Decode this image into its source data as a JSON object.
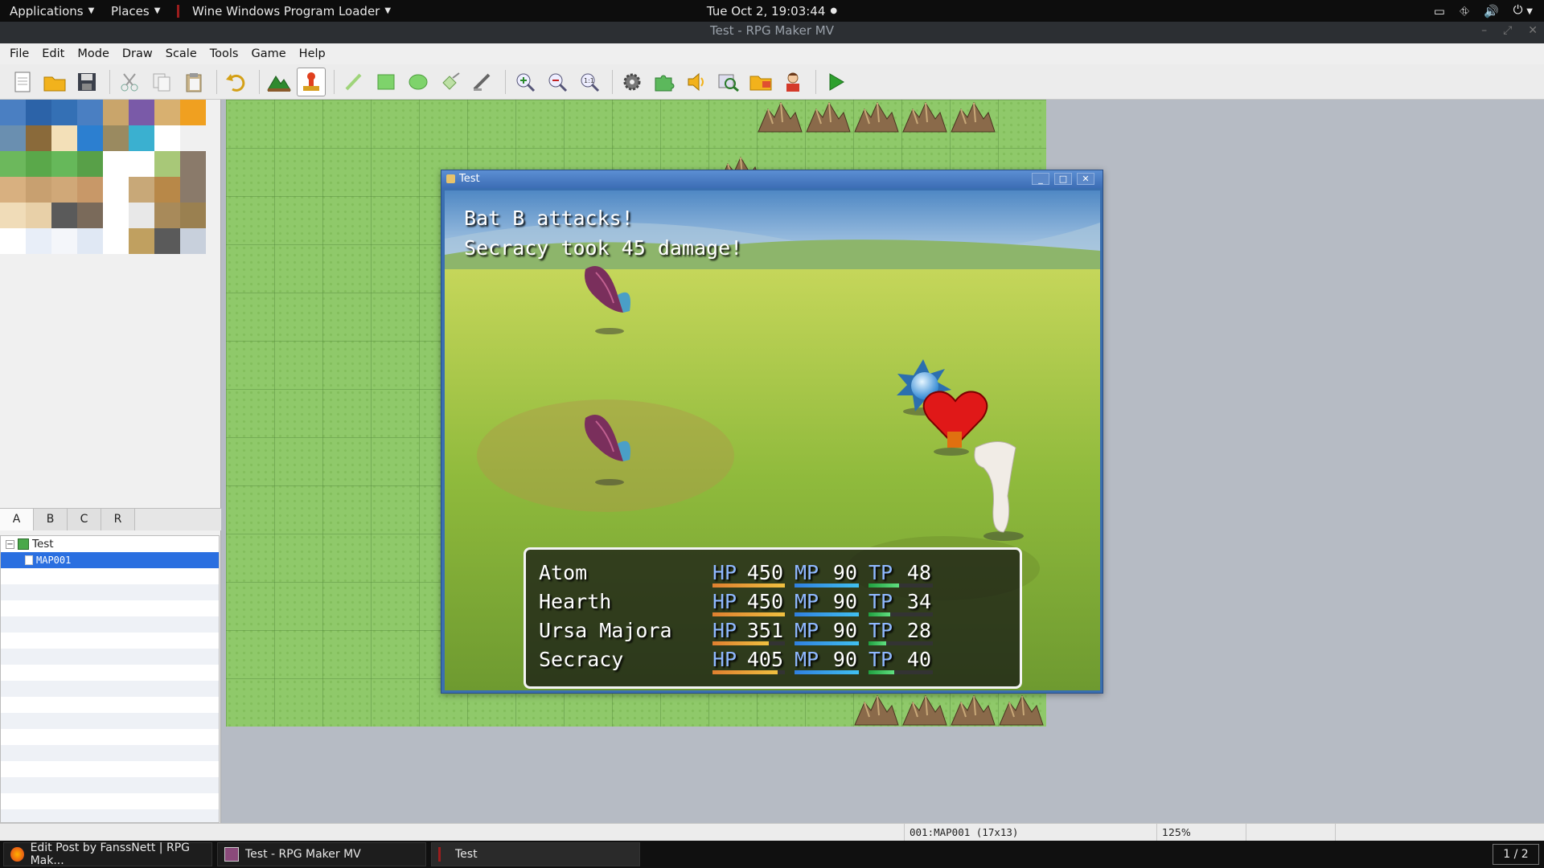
{
  "topbar": {
    "applications": "Applications",
    "places": "Places",
    "wine_loader": "Wine Windows Program Loader",
    "clock": "Tue Oct  2, 19:03:44",
    "tray_icons": [
      "terminal-icon",
      "network-icon",
      "volume-icon",
      "power-icon"
    ]
  },
  "window": {
    "title": "Test - RPG Maker MV"
  },
  "menu": [
    "File",
    "Edit",
    "Mode",
    "Draw",
    "Scale",
    "Tools",
    "Game",
    "Help"
  ],
  "toolbar": {
    "icons": [
      "new-project",
      "open-project",
      "save-project",
      "cut",
      "copy",
      "paste",
      "undo",
      "map-mode",
      "event-mode",
      "pencil",
      "rectangle",
      "ellipse",
      "flood-fill",
      "shadow-pen",
      "zoom-in",
      "zoom-out",
      "actual-size",
      "database",
      "plugin-manager",
      "sound-test",
      "event-searcher",
      "resource-manager",
      "character-generator",
      "playtest"
    ],
    "active": "event-mode"
  },
  "palette_tabs": [
    "A",
    "B",
    "C",
    "R"
  ],
  "palette_selected_tab": "A",
  "map_tree": {
    "project": "Test",
    "maps": [
      "MAP001"
    ],
    "selected": "MAP001"
  },
  "game_window": {
    "title": "Test",
    "message_lines": [
      "Bat B attacks!",
      "Secracy took 45 damage!"
    ],
    "party": [
      {
        "name": "Atom",
        "hp": 450,
        "hp_ratio": 1.0,
        "mp": 90,
        "mp_ratio": 1.0,
        "tp": 48,
        "tp_ratio": 0.48
      },
      {
        "name": "Hearth",
        "hp": 450,
        "hp_ratio": 1.0,
        "mp": 90,
        "mp_ratio": 1.0,
        "tp": 34,
        "tp_ratio": 0.34
      },
      {
        "name": "Ursa Majora",
        "hp": 351,
        "hp_ratio": 0.78,
        "mp": 90,
        "mp_ratio": 1.0,
        "tp": 28,
        "tp_ratio": 0.28
      },
      {
        "name": "Secracy",
        "hp": 405,
        "hp_ratio": 0.9,
        "mp": 90,
        "mp_ratio": 1.0,
        "tp": 40,
        "tp_ratio": 0.4
      }
    ],
    "labels": {
      "hp": "HP",
      "mp": "MP",
      "tp": "TP"
    }
  },
  "statusbar": {
    "map_info": "001:MAP001 (17x13)",
    "zoom": "125%"
  },
  "taskbar": {
    "tasks": [
      "Edit Post by FanssNett | RPG Mak...",
      "Test - RPG Maker MV",
      "Test"
    ],
    "active_task": "Test",
    "pager": "1 / 2"
  },
  "colors": {
    "accent": "#2a6fe0",
    "grass": "#8fc96a",
    "hp": "#f0a030",
    "mp": "#40a0f0",
    "tp": "#40d060"
  }
}
